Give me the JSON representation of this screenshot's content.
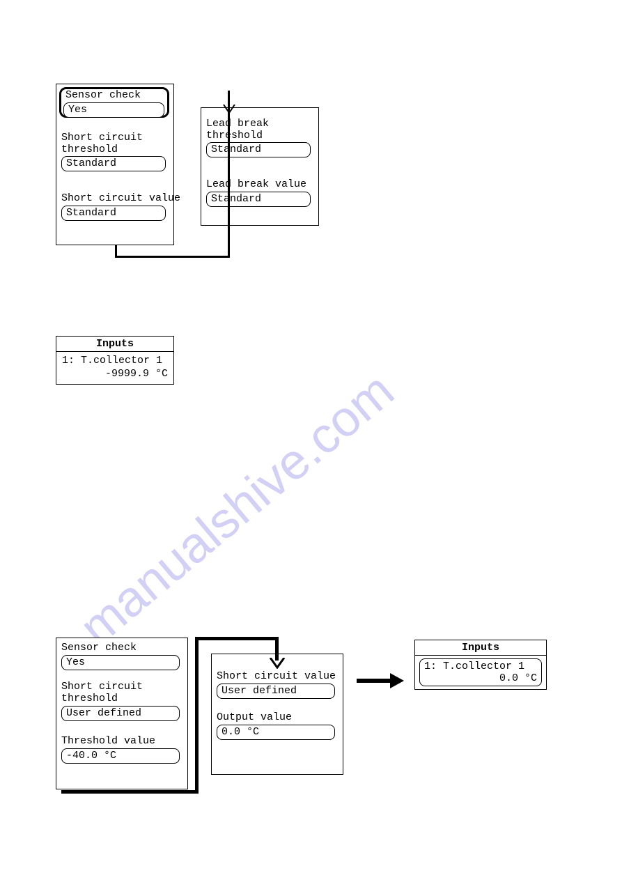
{
  "watermark": "manualshive.com",
  "top": {
    "panel1": {
      "sensor_check_label": "Sensor check",
      "sensor_check_value": "Yes",
      "sc_threshold_label": "Short circuit\nthreshold",
      "sc_threshold_value": "Standard",
      "sc_value_label": "Short circuit value",
      "sc_value_value": "Standard"
    },
    "panel2": {
      "lb_threshold_label": "Lead break\nthreshold",
      "lb_threshold_value": "Standard",
      "lb_value_label": "Lead break value",
      "lb_value_value": "Standard"
    }
  },
  "inputs1": {
    "title": "Inputs",
    "line1": "1: T.collector 1",
    "line2": "-9999.9 °C"
  },
  "bottom": {
    "panel1": {
      "sensor_check_label": "Sensor check",
      "sensor_check_value": "Yes",
      "sc_threshold_label": "Short circuit\nthreshold",
      "sc_threshold_value": "User defined",
      "thresh_val_label": "Threshold value",
      "thresh_val_value": "-40.0 °C"
    },
    "panel2": {
      "sc_value_label": "Short circuit value",
      "sc_value_value": "User defined",
      "output_label": "Output value",
      "output_value": "0.0 °C"
    }
  },
  "inputs2": {
    "title": "Inputs",
    "line1": "1: T.collector 1",
    "line2": "0.0 °C"
  }
}
